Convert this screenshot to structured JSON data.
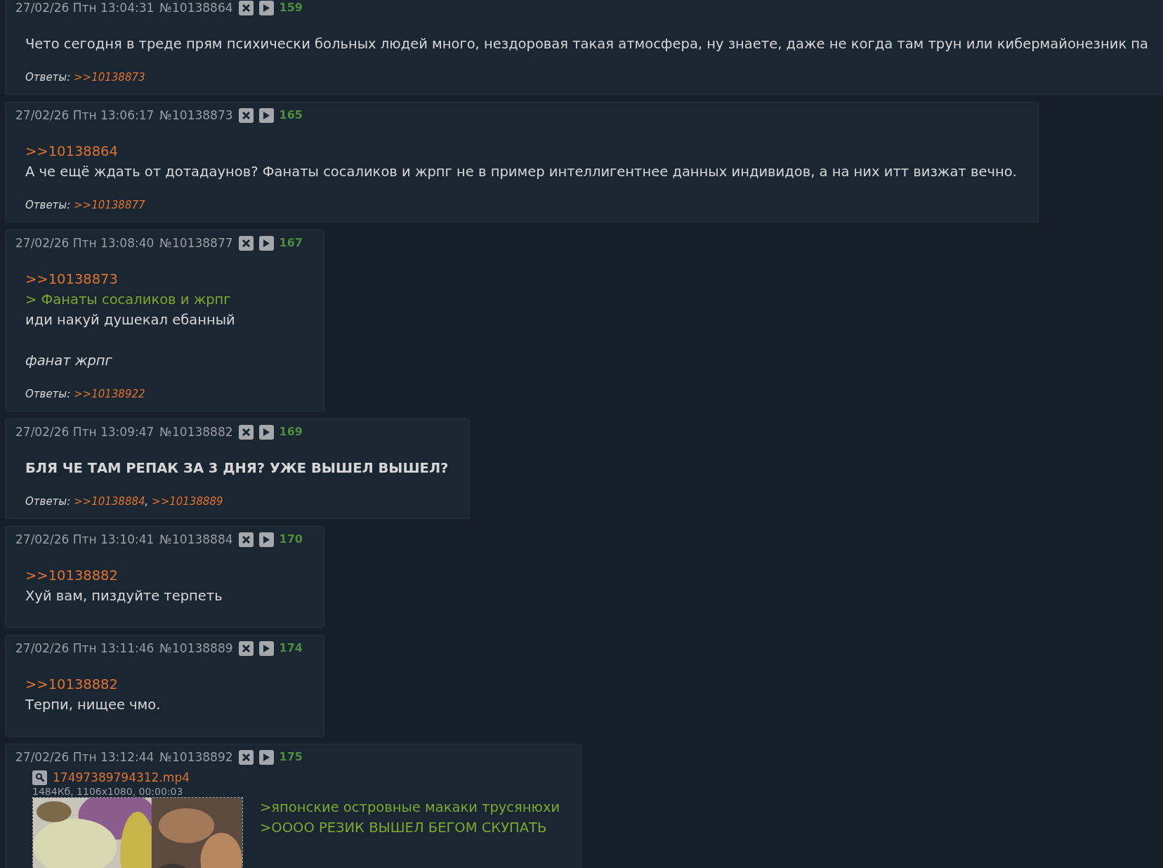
{
  "posts": [
    {
      "date": "27/02/26 Птн 13:04:31",
      "number": "№10138864",
      "count": "159",
      "lines": [
        {
          "kind": "text",
          "text": "Чето сегодня в треде прям психически больных людей много, нездоровая такая атмосфера, ну знаете, даже не когда там трун или кибермайонезник па"
        }
      ],
      "replies": {
        "label": "Ответы:",
        "links": [
          ">>10138873"
        ]
      }
    },
    {
      "date": "27/02/26 Птн 13:06:17",
      "number": "№10138873",
      "count": "165",
      "lines": [
        {
          "kind": "link",
          "text": ">>10138864"
        },
        {
          "kind": "text",
          "text": "А че ещё ждать от дотадаунов? Фанаты сосаликов и жрпг не в пример интеллигентнее данных индивидов, а на них итт визжат вечно."
        }
      ],
      "replies": {
        "label": "Ответы:",
        "links": [
          ">>10138877"
        ]
      }
    },
    {
      "date": "27/02/26 Птн 13:08:40",
      "number": "№10138877",
      "count": "167",
      "lines": [
        {
          "kind": "link",
          "text": ">>10138873"
        },
        {
          "kind": "quote",
          "text": "> Фанаты сосаликов и жрпг"
        },
        {
          "kind": "text",
          "text": "иди накуй душекал ебанный"
        },
        {
          "kind": "italic",
          "text": "фанат жрпг",
          "gap_before": true
        }
      ],
      "replies": {
        "label": "Ответы:",
        "links": [
          ">>10138922"
        ]
      }
    },
    {
      "date": "27/02/26 Птн 13:09:47",
      "number": "№10138882",
      "count": "169",
      "lines": [
        {
          "kind": "bold",
          "text": "БЛЯ ЧЕ ТАМ РЕПАК ЗА 3 ДНЯ? УЖЕ ВЫШЕЛ ВЫШЕЛ?"
        }
      ],
      "replies": {
        "label": "Ответы:",
        "separator": ",",
        "links": [
          ">>10138884",
          ">>10138889"
        ]
      }
    },
    {
      "date": "27/02/26 Птн 13:10:41",
      "number": "№10138884",
      "count": "170",
      "lines": [
        {
          "kind": "link",
          "text": ">>10138882"
        },
        {
          "kind": "text",
          "text": "Хуй вам, пиздуйте терпеть"
        }
      ]
    },
    {
      "date": "27/02/26 Птн 13:11:46",
      "number": "№10138889",
      "count": "174",
      "lines": [
        {
          "kind": "link",
          "text": ">>10138882"
        },
        {
          "kind": "text",
          "text": "Терпи, нищее чмо."
        }
      ]
    },
    {
      "date": "27/02/26 Птн 13:12:44",
      "number": "№10138892",
      "count": "175",
      "file": {
        "name": "17497389794312.mp4",
        "meta": "1484Кб, 1106x1080, 00:00:03"
      },
      "lines": [
        {
          "kind": "quote",
          "text": ">японские островные макаки трусянюхи"
        },
        {
          "kind": "quote",
          "text": ">ОООО РЕЗИК ВЫШЕЛ БЕГОМ СКУПАТЬ"
        }
      ]
    }
  ]
}
